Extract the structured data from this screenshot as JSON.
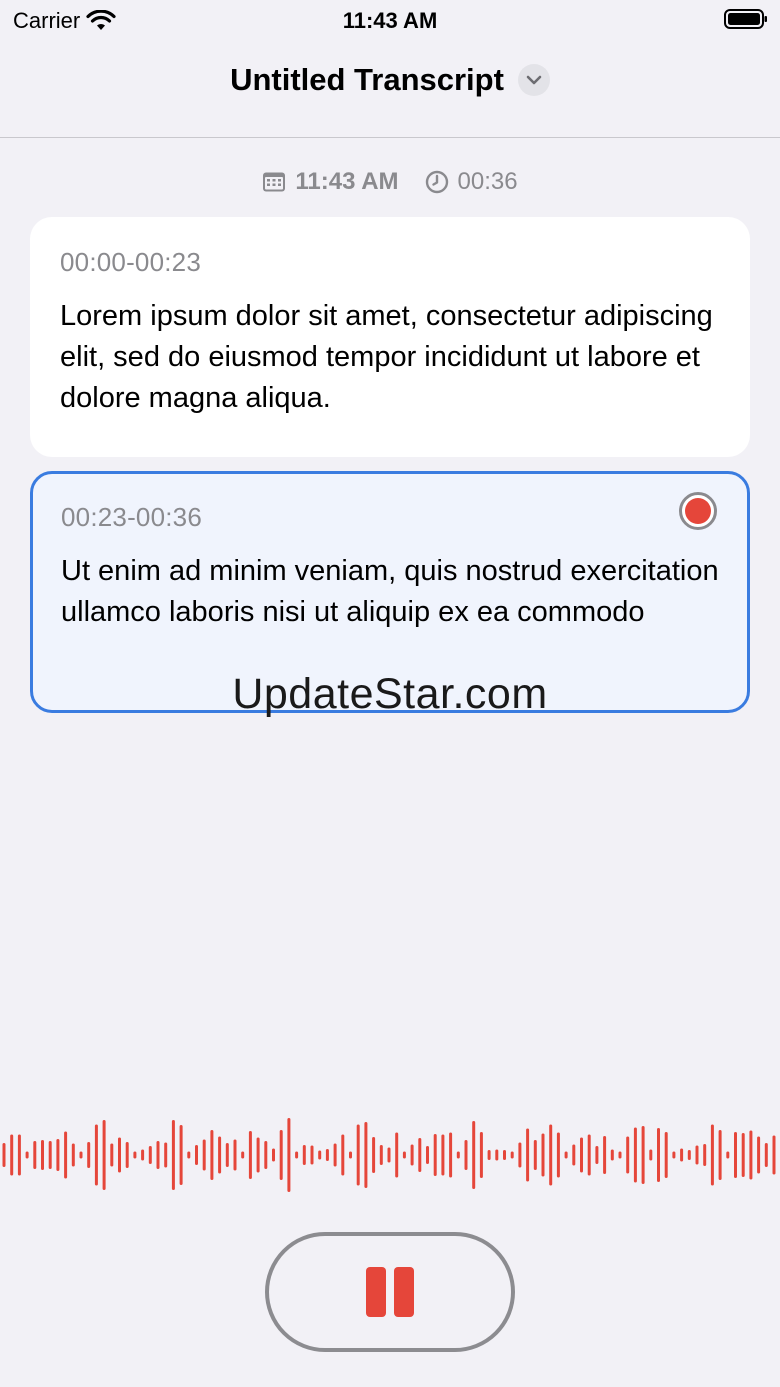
{
  "status_bar": {
    "carrier": "Carrier",
    "time": "11:43 AM"
  },
  "nav": {
    "title": "Untitled Transcript",
    "dropdown_icon": "chevron-down-icon"
  },
  "meta": {
    "date_icon": "calendar-icon",
    "start_time": "11:43 AM",
    "duration_icon": "clock-icon",
    "duration": "00:36"
  },
  "segments": [
    {
      "range": "00:00-00:23",
      "text": "Lorem ipsum dolor sit amet, consectetur adipiscing elit, sed do eiusmod tempor incididunt ut labore et dolore magna aliqua."
    },
    {
      "range": "00:23-00:36",
      "text": "Ut enim ad minim veniam, quis nostrud exercitation ullamco laboris nisi ut aliquip ex ea commodo",
      "recording": true
    }
  ],
  "watermark": "UpdateStar.com",
  "controls": {
    "pause_icon": "pause-icon"
  },
  "colors": {
    "accent_red": "#e5463a",
    "selection_blue": "#3a7ce0",
    "background": "#f2f1f6",
    "secondary_text": "#8a8a8e"
  }
}
